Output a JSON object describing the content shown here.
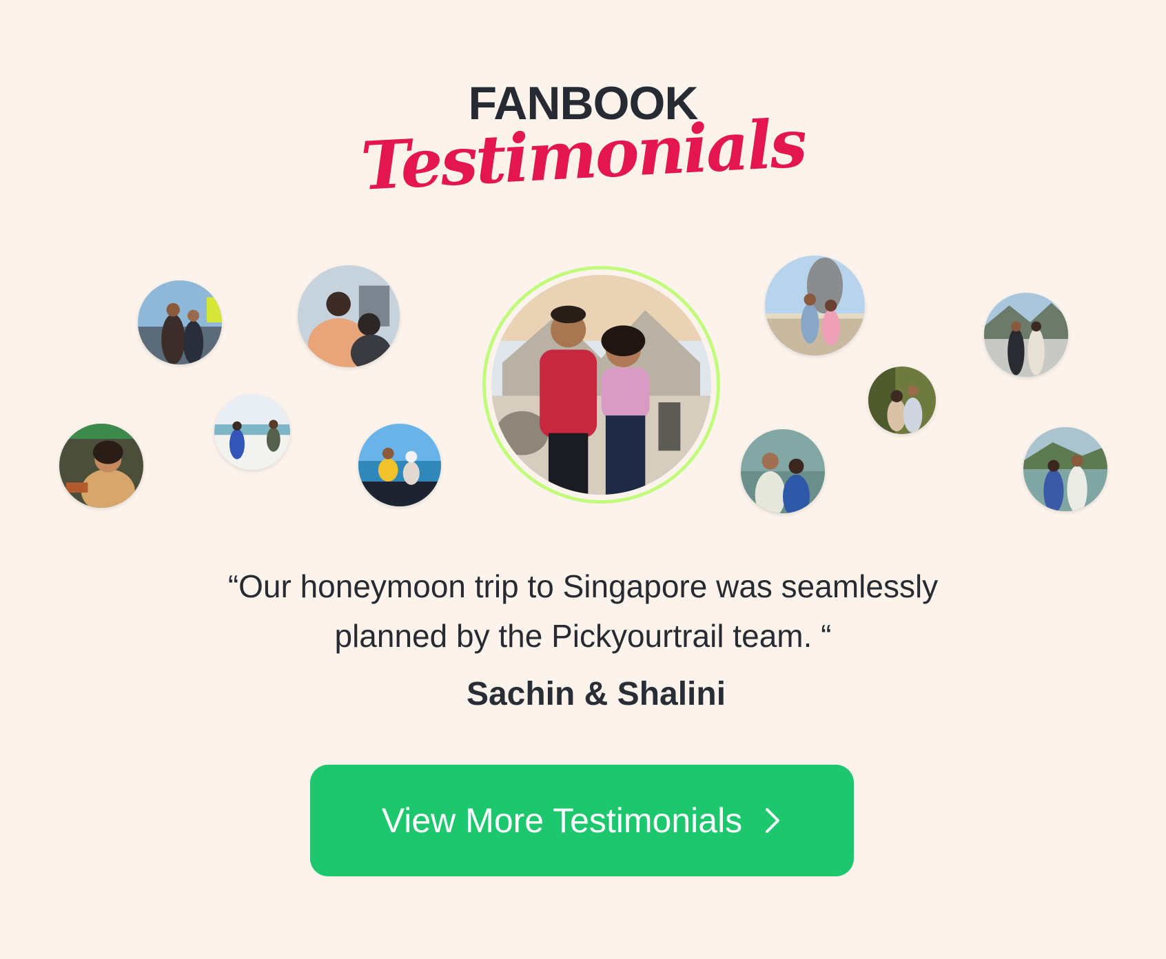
{
  "header": {
    "title": "FANBOOK",
    "subtitle": "Testimonials"
  },
  "testimonial": {
    "quote": "“Our honeymoon trip to Singapore was seamlessly planned by the Pickyourtrail team. “",
    "author": "Sachin & Shalini"
  },
  "cta": {
    "label": "View More Testimonials",
    "icon": "chevron-right-icon"
  },
  "colors": {
    "background": "#fcf4ec",
    "accent_pink": "#e4164f",
    "cta_green": "#1cc76d",
    "featured_ring": "#c2fa7c"
  }
}
